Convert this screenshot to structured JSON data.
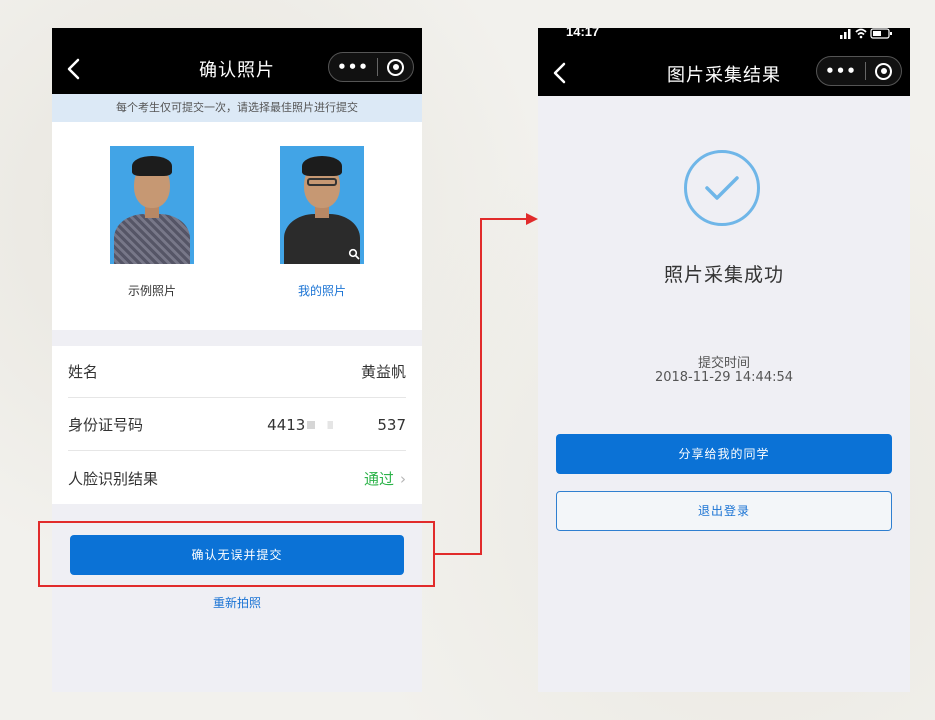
{
  "screen1": {
    "status_time": "",
    "title": "确认照片",
    "notice": "每个考生仅可提交一次，请选择最佳照片进行提交",
    "photos": [
      {
        "label": "示例照片"
      },
      {
        "label": "我的照片"
      }
    ],
    "info_rows": [
      {
        "label": "姓名",
        "value": "黄益帆"
      },
      {
        "label": "身份证号码",
        "value_prefix": "4413",
        "value_suffix": "537"
      },
      {
        "label": "人脸识别结果",
        "value": "通过"
      }
    ],
    "confirm_button": "确认无误并提交",
    "retake_link": "重新拍照",
    "capsule_more": "•••"
  },
  "screen2": {
    "status_time": "14:17",
    "title": "图片采集结果",
    "success_title": "照片采集成功",
    "submit_label": "提交时间",
    "submit_time": "2018-11-29 14:44:54",
    "share_button": "分享给我的同学",
    "logout_button": "退出登录",
    "capsule_more": "•••"
  },
  "colors": {
    "primary_blue": "#0b72d6",
    "success_green": "#2db34a",
    "annotation_red": "#e12b2b",
    "notice_bg": "#dce9f6"
  }
}
